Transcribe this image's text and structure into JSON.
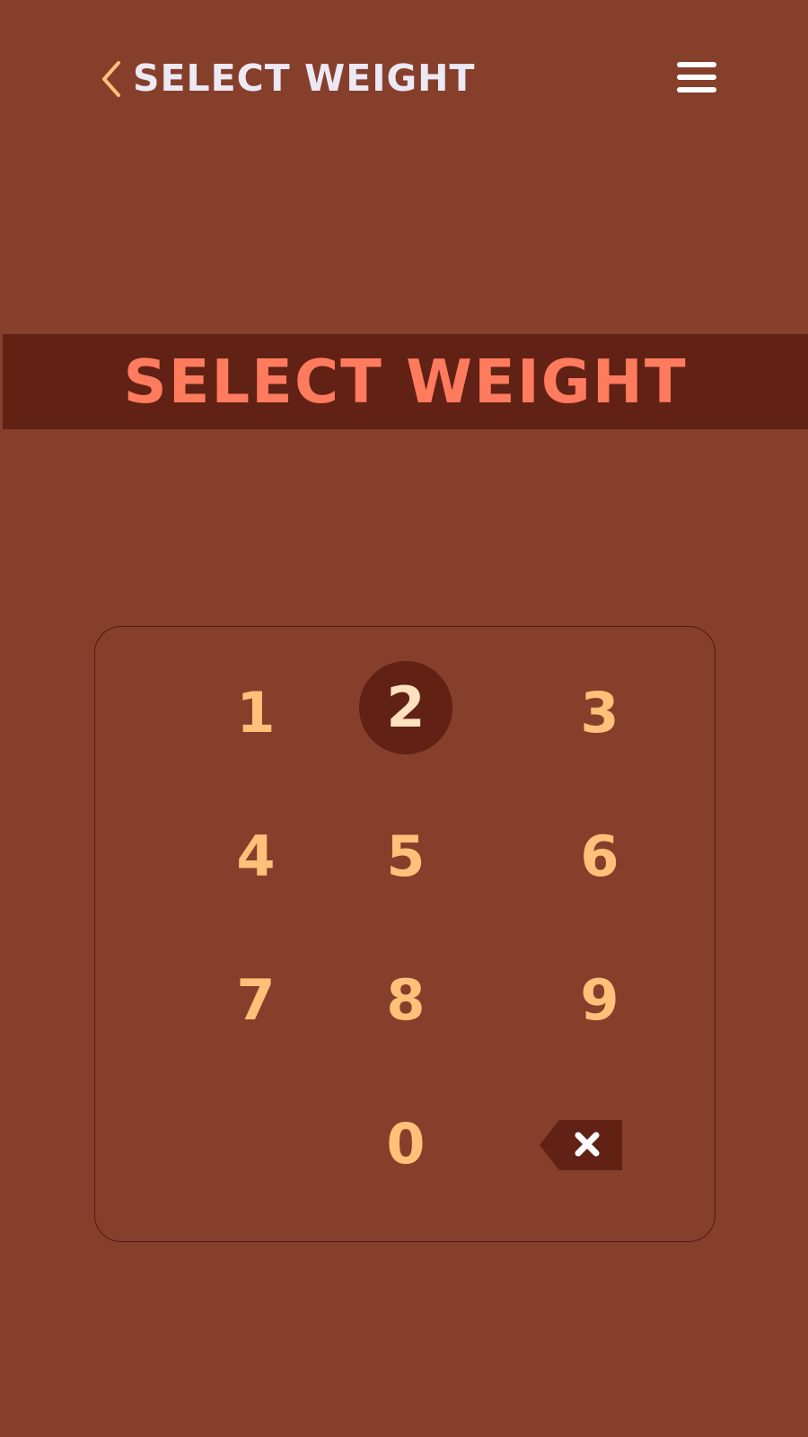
{
  "header": {
    "title": "SELECT WEIGHT",
    "back_icon": "chevron-left-icon",
    "menu_icon": "hamburger-menu-icon"
  },
  "banner": {
    "title": "SELECT WEIGHT"
  },
  "keypad": {
    "keys": [
      "1",
      "2",
      "3",
      "4",
      "5",
      "6",
      "7",
      "8",
      "9",
      "0"
    ],
    "pressed_key": "2",
    "backspace_icon": "backspace-icon"
  },
  "colors": {
    "background": "#853f2b",
    "banner_background": "#612115",
    "banner_text": "#ff7b5e",
    "key_text": "#ffc07a",
    "header_text": "#ece8f4",
    "back_chevron": "#ffc07a"
  }
}
